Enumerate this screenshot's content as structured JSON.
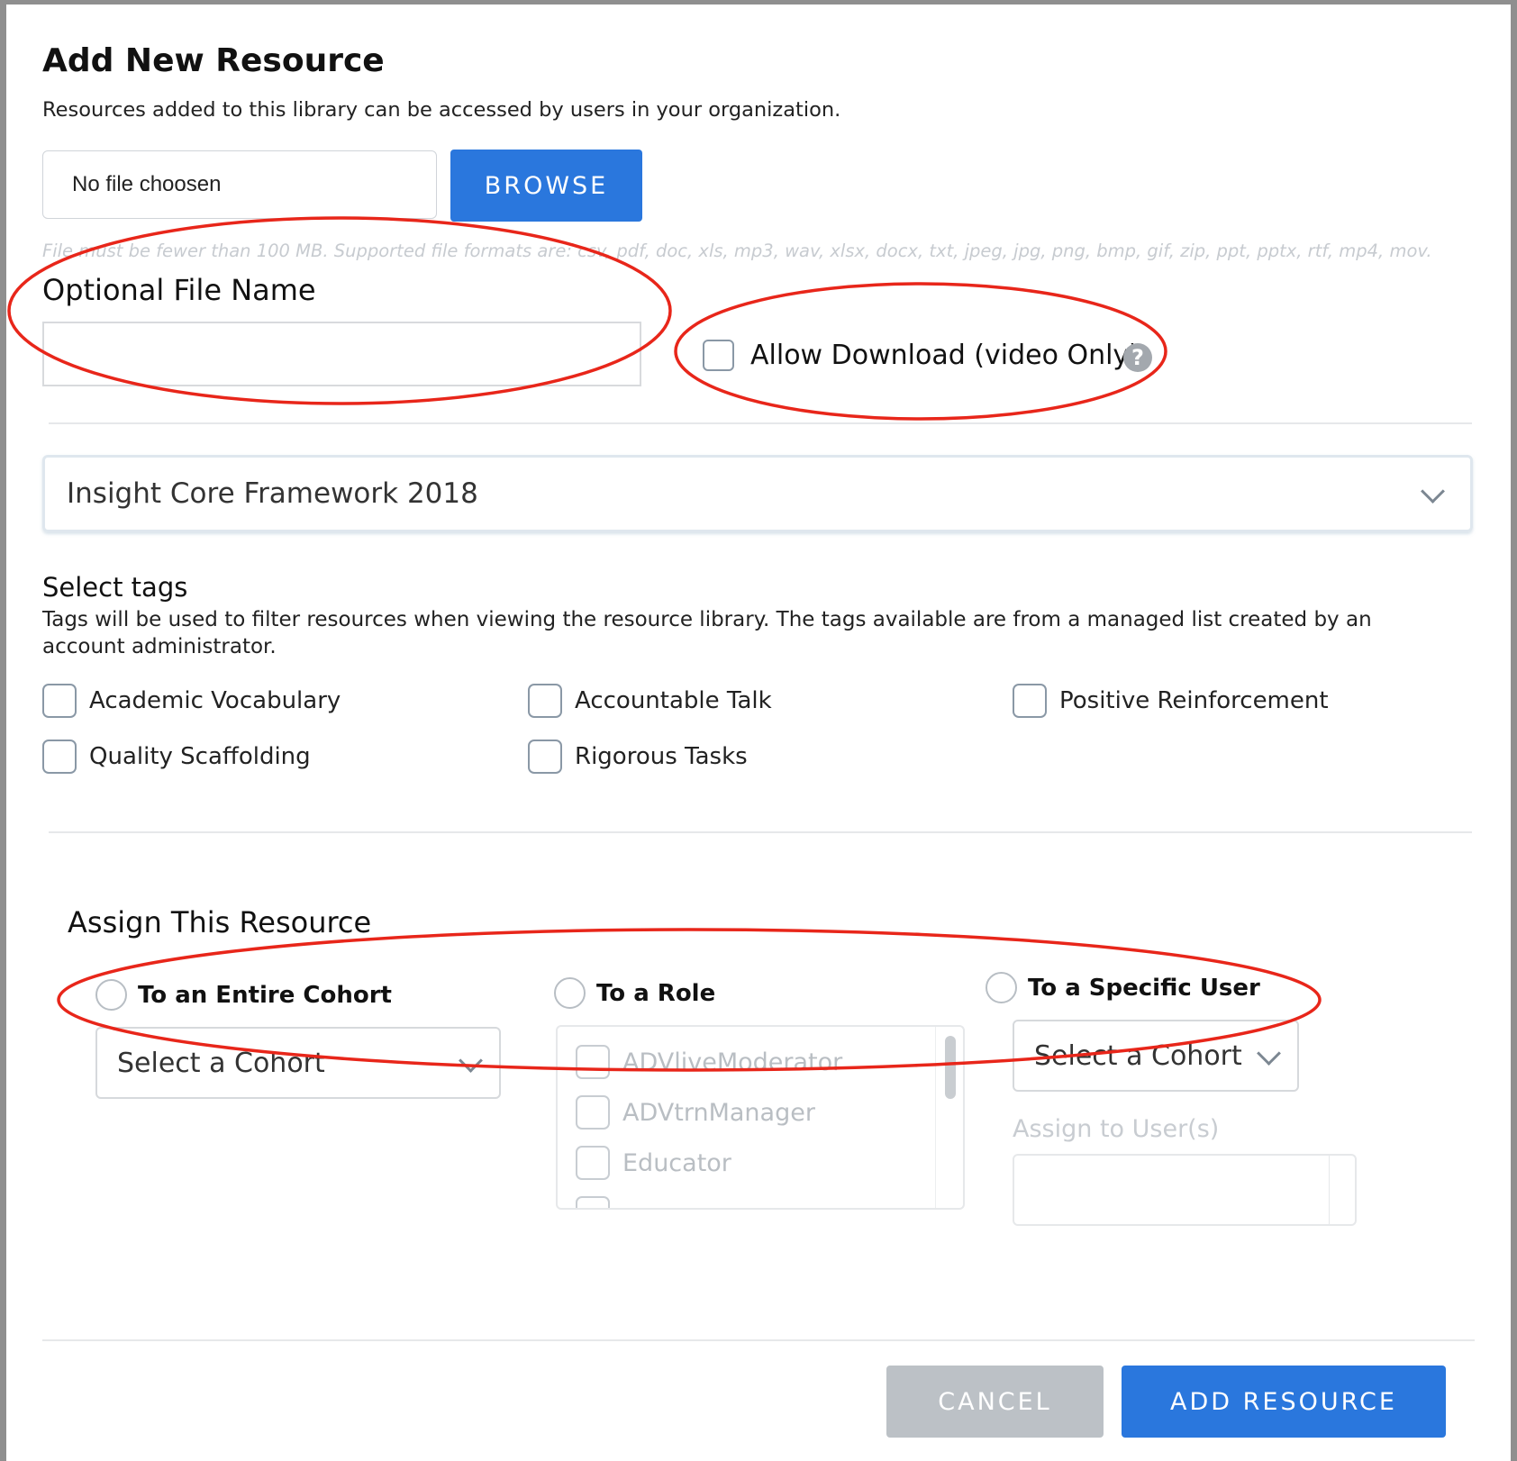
{
  "dialog": {
    "title": "Add New Resource",
    "subtitle": "Resources added to this library can be accessed by users in your organization."
  },
  "file": {
    "chosen_text": "No file choosen",
    "browse_label": "BROWSE",
    "formats_note": "File must be fewer than 100 MB. Supported file formats are: csv, pdf, doc, xls, mp3, wav, xlsx, docx, txt, jpeg, jpg, png, bmp, gif, zip, ppt, pptx, rtf, mp4, mov."
  },
  "optional_name": {
    "label": "Optional File Name",
    "value": ""
  },
  "allow_download": {
    "label": "Allow Download (video Only)",
    "checked": false,
    "help_glyph": "?"
  },
  "framework": {
    "selected": "Insight Core Framework 2018"
  },
  "tags": {
    "heading": "Select tags",
    "description": "Tags will be used to filter resources when viewing the resource library. The tags available are from a managed list created by an account administrator.",
    "items": [
      {
        "label": "Academic Vocabulary",
        "checked": false
      },
      {
        "label": "Accountable Talk",
        "checked": false
      },
      {
        "label": "Positive Reinforcement",
        "checked": false
      },
      {
        "label": "Quality Scaffolding",
        "checked": false
      },
      {
        "label": "Rigorous Tasks",
        "checked": false
      }
    ]
  },
  "assign": {
    "heading": "Assign This Resource",
    "cohort_option": "To an Entire Cohort",
    "role_option": "To a Role",
    "user_option": "To a Specific User",
    "cohort_placeholder": "Select a Cohort",
    "roles": [
      "ADVliveModerator",
      "ADVtrnManager",
      "Educator"
    ],
    "user_cohort_placeholder": "Select a Cohort",
    "assign_users_label": "Assign to User(s)"
  },
  "footer": {
    "cancel_label": "CANCEL",
    "add_label": "ADD RESOURCE"
  },
  "colors": {
    "primary": "#2a77dd",
    "annotation": "#e8261a",
    "disabled": "#bcc1c6"
  }
}
